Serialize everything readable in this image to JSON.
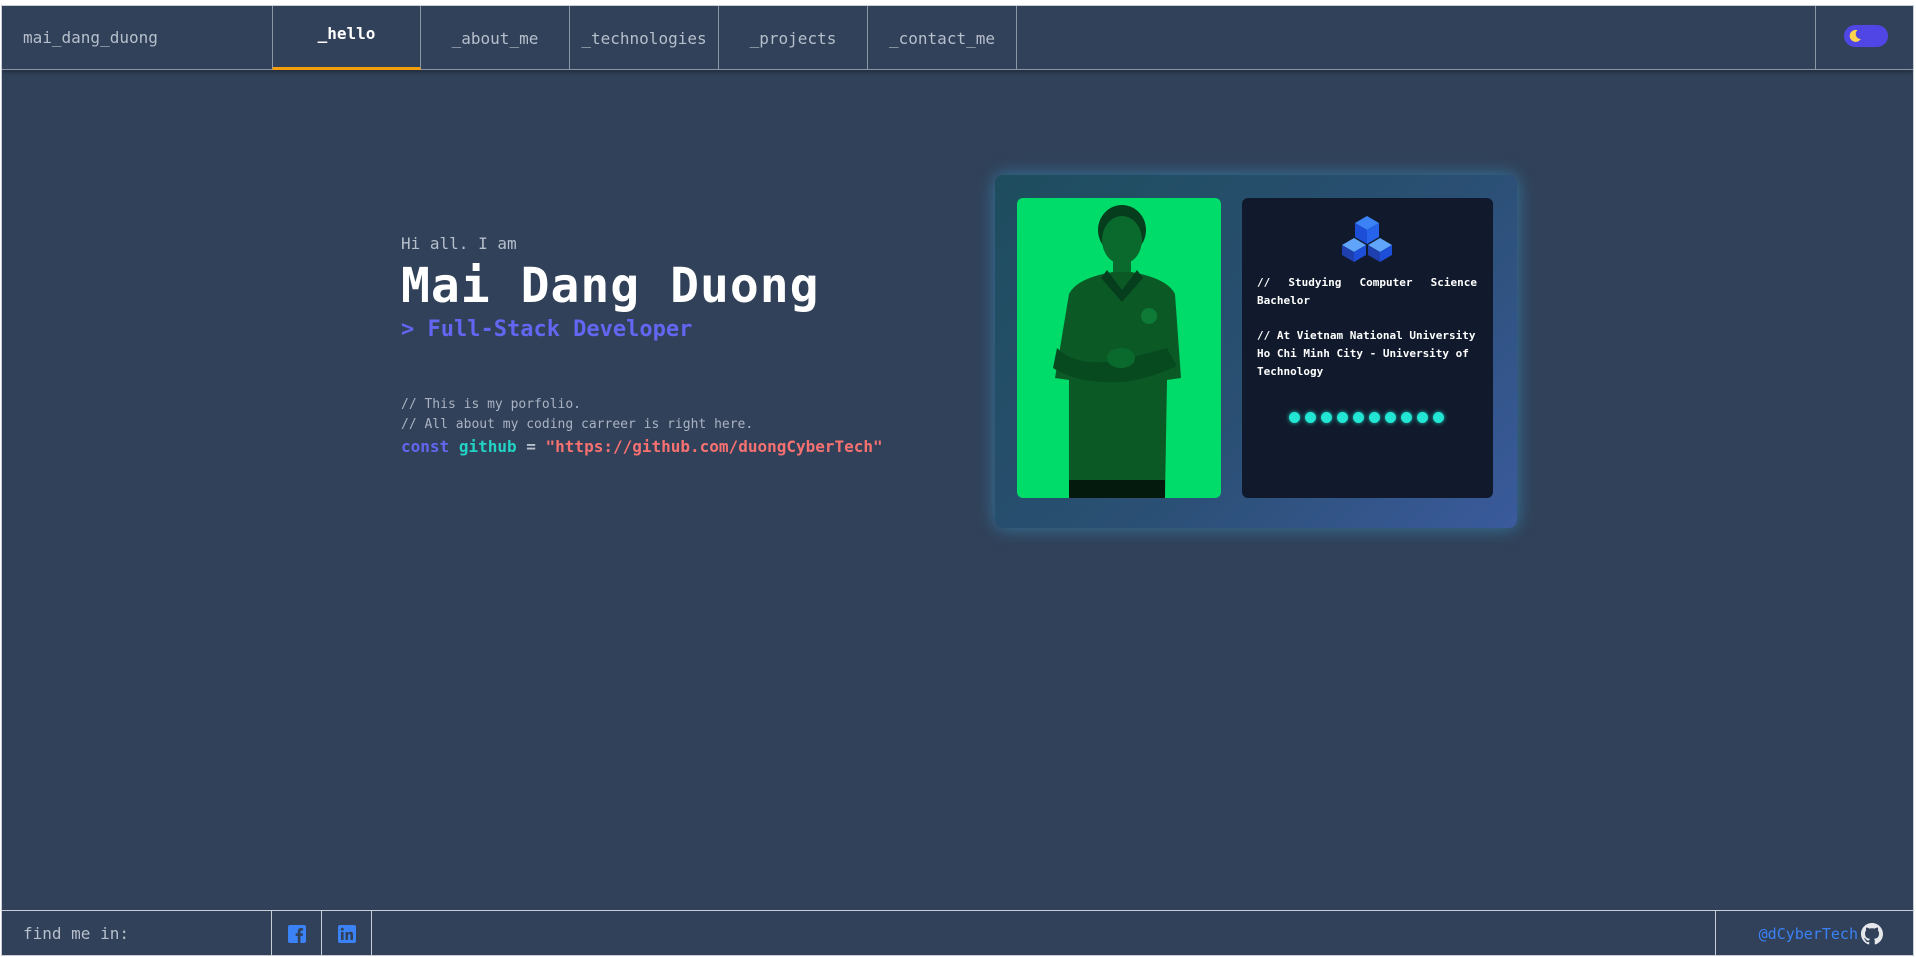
{
  "header": {
    "brand": "mai_dang_duong",
    "tabs": [
      {
        "label": "_hello",
        "active": true
      },
      {
        "label": "_about_me",
        "active": false
      },
      {
        "label": "_technologies",
        "active": false
      },
      {
        "label": "_projects",
        "active": false
      },
      {
        "label": "_contact_me",
        "active": false
      }
    ],
    "theme_toggle_icon": "moon-icon"
  },
  "hero": {
    "greeting": "Hi all. I am",
    "name": "Mai Dang Duong",
    "role": "> Full-Stack Developer",
    "comments": [
      "// This is my porfolio.",
      "// All about my coding carreer is right here."
    ],
    "code": {
      "keyword": "const",
      "variable": "github",
      "operator": "=",
      "value": "\"https://github.com/duongCyberTech\""
    }
  },
  "card": {
    "photo_icon": "profile-photo",
    "logo_icon": "university-logo-icon",
    "study": "// Studying Computer Science Bachelor",
    "university": "// At Vietnam National University Ho Chi Minh City - University of Technology",
    "dot_count": 10
  },
  "footer": {
    "find_label": "find me in:",
    "social": [
      {
        "name": "facebook-icon"
      },
      {
        "name": "linkedin-icon"
      }
    ],
    "github_handle": "@dCyberTech",
    "github_icon": "github-icon"
  },
  "colors": {
    "background": "#314159",
    "accent_tab": "#f59e0b",
    "role": "#6366f1",
    "variable": "#22d3c5",
    "string": "#f87171",
    "photo_bg": "#00dc6a",
    "dots": "#22e5d4",
    "link": "#3b82f6"
  }
}
